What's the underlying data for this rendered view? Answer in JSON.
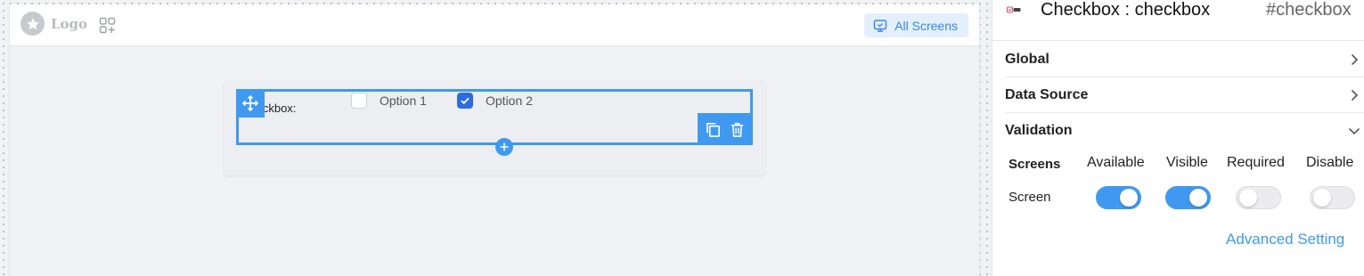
{
  "topbar": {
    "logo_text": "Logo",
    "screens_button": "All Screens",
    "accent": "#3f99f0"
  },
  "form": {
    "field_label": "Checkbox:",
    "options": [
      {
        "label": "Option 1",
        "checked": false
      },
      {
        "label": "Option 2",
        "checked": true
      }
    ]
  },
  "panel": {
    "component_title": "Checkbox : checkbox",
    "component_id": "#checkbox",
    "sections": [
      {
        "label": "Global",
        "expanded": false
      },
      {
        "label": "Data Source",
        "expanded": false
      },
      {
        "label": "Validation",
        "expanded": true
      }
    ],
    "validation": {
      "columns": [
        "Screens",
        "Available",
        "Visible",
        "Required",
        "Disable"
      ],
      "rows": [
        {
          "label": "Screen",
          "available": true,
          "visible": true,
          "required": false,
          "disable": false
        }
      ]
    },
    "advanced_link": "Advanced Setting"
  },
  "icons": [
    "star-logo-icon",
    "apps-add-icon",
    "monitor-icon",
    "move-icon",
    "copy-icon",
    "trash-icon",
    "plus-icon",
    "checkbox-component-icon",
    "chevron-right-icon",
    "chevron-down-icon"
  ]
}
